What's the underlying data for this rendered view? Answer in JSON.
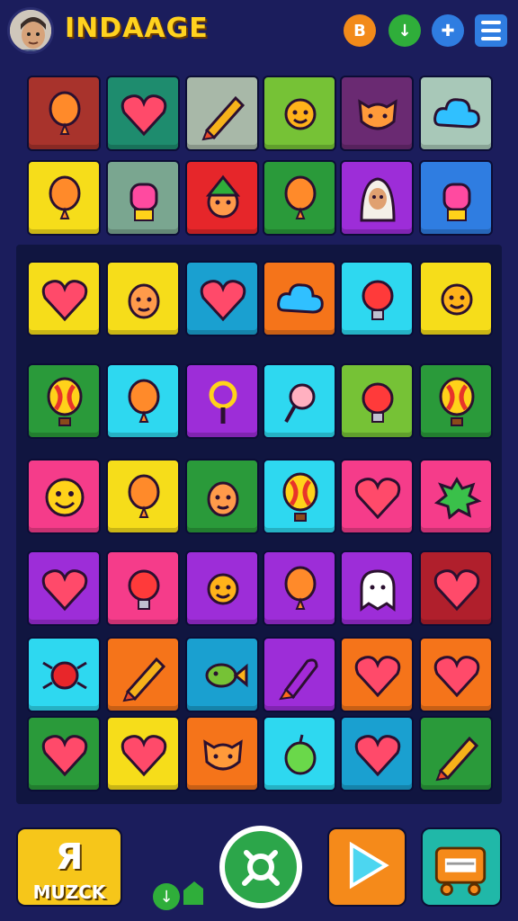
{
  "header": {
    "title": "INDAAGE",
    "avatar": "player-avatar",
    "buttons": [
      {
        "name": "coin-button",
        "glyph": "B",
        "color": "#f28a1a"
      },
      {
        "name": "download-button",
        "glyph": "↓",
        "color": "#2fae3a"
      },
      {
        "name": "puzzle-button",
        "glyph": "✚",
        "color": "#2f7de1"
      },
      {
        "name": "menu-button",
        "glyph": "≡",
        "color": "#2f7de1"
      }
    ]
  },
  "colors": {
    "background": "#1b1d5c",
    "board": "#101540",
    "title": "#ffd21f"
  },
  "grid": [
    [
      "#a8332c",
      "#1e8c6e",
      "#a8b8a8",
      "#76c236",
      "#6a2a72",
      "#a8c8b8"
    ],
    [
      "#f6dd1a",
      "#7aa690",
      "#e6262a",
      "#2a9a3a",
      "#9d2dd8",
      "#2f7de1"
    ],
    [
      "#f6dd1a",
      "#f6dd1a",
      "#1aa0d0",
      "#f5741a",
      "#2ed8f0",
      "#f6dd1a"
    ],
    [
      "#2a9a3a",
      "#2ed8f0",
      "#9d2dd8",
      "#2ed8f0",
      "#76c236",
      "#2a9a3a"
    ],
    [
      "#f53c8a",
      "#f6dd1a",
      "#2a9a3a",
      "#2ed8f0",
      "#f53c8a",
      "#f53c8a"
    ],
    [
      "#9d2dd8",
      "#f53c8a",
      "#9d2dd8",
      "#9d2dd8",
      "#9d2dd8",
      "#b01f2c"
    ],
    [
      "#2ed8f0",
      "#f5741a",
      "#1aa0d0",
      "#9d2dd8",
      "#f5741a",
      "#f5741a"
    ],
    [
      "#2a9a3a",
      "#f6dd1a",
      "#f5741a",
      "#2ed8f0",
      "#1aa0d0",
      "#2a9a3a"
    ]
  ],
  "pieces": [
    [
      "balloon-piece",
      "heart-piece",
      "pencil-piece",
      "sun-face-piece",
      "cat-face-piece",
      "cloud-piece"
    ],
    [
      "balloon-piece",
      "lantern-piece",
      "elf-face-piece",
      "balloon-piece",
      "girl-face-piece",
      "lantern-piece"
    ],
    [
      "heart-piece",
      "face-piece",
      "heart-piece",
      "cloud-piece",
      "bulb-piece",
      "sun-face-piece"
    ],
    [
      "hot-air-balloon-piece",
      "balloon-piece",
      "magnifier-piece",
      "candy-piece",
      "bulb-piece",
      "hot-air-balloon-piece"
    ],
    [
      "smiley-piece",
      "balloon-piece",
      "face-piece",
      "hot-air-balloon-piece",
      "heart-piece",
      "splat-piece"
    ],
    [
      "heart-piece",
      "bulb-piece",
      "sun-face-piece",
      "balloon-piece",
      "ghost-piece",
      "heart-piece"
    ],
    [
      "bug-piece",
      "pencil-piece",
      "fish-piece",
      "rocket-piece",
      "heart-piece",
      "heart-piece"
    ],
    [
      "heart-piece",
      "heart-piece",
      "cat-face-piece",
      "apple-piece",
      "heart-piece",
      "pencil-piece"
    ]
  ],
  "bottom": {
    "left_button_label": "MUZCK",
    "left_button_glyph": "Я",
    "center_button": "search-button",
    "right_buttons": [
      "play-button",
      "shop-button"
    ]
  }
}
